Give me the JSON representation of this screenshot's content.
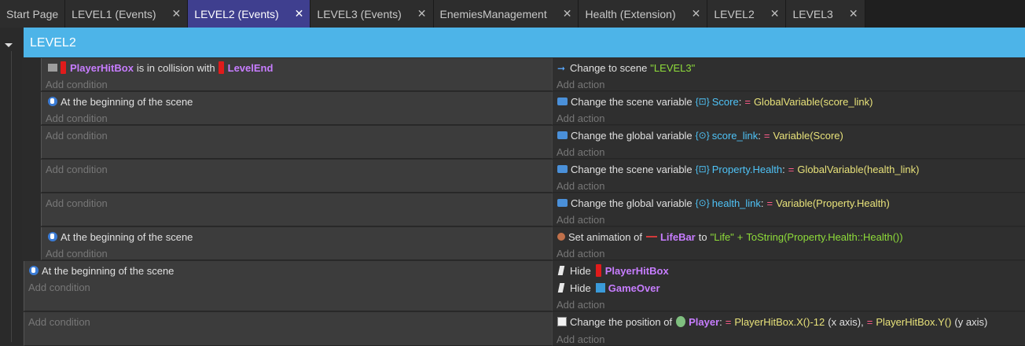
{
  "tabs": [
    {
      "label": "Start Page",
      "active": false,
      "closable": false
    },
    {
      "label": "LEVEL1 (Events)",
      "active": false,
      "closable": true
    },
    {
      "label": "LEVEL2 (Events)",
      "active": true,
      "closable": true
    },
    {
      "label": "LEVEL3 (Events)",
      "active": false,
      "closable": true
    },
    {
      "label": "EnemiesManagement",
      "active": false,
      "closable": true
    },
    {
      "label": "Health (Extension)",
      "active": false,
      "closable": true
    },
    {
      "label": "LEVEL2",
      "active": false,
      "closable": true
    },
    {
      "label": "LEVEL3",
      "active": false,
      "closable": true
    }
  ],
  "close_glyph": "✕",
  "group": {
    "title": "LEVEL2"
  },
  "placeholders": {
    "add_condition": "Add condition",
    "add_action": "Add action"
  },
  "events": {
    "e1": {
      "cond_obj1": "PlayerHitBox",
      "cond_text": "is in collision with",
      "cond_obj2": "LevelEnd",
      "act_text": "Change to scene",
      "act_value": "\"LEVEL3\""
    },
    "e2": {
      "cond_text": "At the beginning of the scene",
      "act_text": "Change the scene variable",
      "act_var": "Score",
      "act_colon": ":",
      "act_op": "=",
      "act_expr": "GlobalVariable(score_link)"
    },
    "e3": {
      "act_text": "Change the global variable",
      "act_var": "score_link",
      "act_colon": ":",
      "act_op": "=",
      "act_expr": "Variable(Score)"
    },
    "e4": {
      "act_text": "Change the scene variable",
      "act_var": "Property.Health",
      "act_colon": ":",
      "act_op": "=",
      "act_expr": "GlobalVariable(health_link)"
    },
    "e5": {
      "act_text": "Change the global variable",
      "act_var": "health_link",
      "act_colon": ":",
      "act_op": "=",
      "act_expr": "Variable(Property.Health)"
    },
    "e6": {
      "cond_text": "At the beginning of the scene",
      "act_text": "Set animation of",
      "act_obj": "LifeBar",
      "act_to": "to",
      "act_str": "\"Life\"",
      "act_plus": "+",
      "act_expr": "ToString(Property.Health::Health())"
    },
    "e7": {
      "cond_text": "At the beginning of the scene",
      "act1_text": "Hide",
      "act1_obj": "PlayerHitBox",
      "act2_text": "Hide",
      "act2_obj": "GameOver"
    },
    "e8": {
      "act_text": "Change the position of",
      "act_obj": "Player",
      "act_colon": ":",
      "act_op1": "=",
      "act_expr1": "PlayerHitBox.X()-12",
      "act_axis1": "(x axis),",
      "act_op2": "=",
      "act_expr2": "PlayerHitBox.Y()",
      "act_axis2": "(y axis)"
    }
  },
  "colors": {
    "accent_tab": "#3f3f8f",
    "group_header": "#4db4e8",
    "object": "#c77dff",
    "variable": "#4fc3f7",
    "string": "#8fdd3a",
    "expression": "#e8e27a",
    "operator": "#ff5c8a"
  }
}
